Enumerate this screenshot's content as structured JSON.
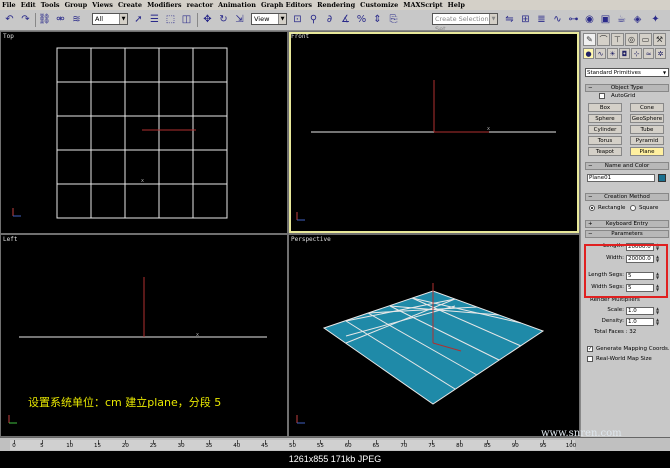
{
  "menu": [
    "File",
    "Edit",
    "Tools",
    "Group",
    "Views",
    "Create",
    "Modifiers",
    "reactor",
    "Animation",
    "Graph Editors",
    "Rendering",
    "Customize",
    "MAXScript",
    "Help"
  ],
  "toolbar": {
    "selection_filter": "All",
    "reference_coord": "View",
    "named_selection_placeholder": "Create Selection Set"
  },
  "viewports": {
    "top": "Top",
    "front": "Front",
    "left": "Left",
    "perspective": "Perspective"
  },
  "caption": "设置系统单位：cm 建立plane，分段 5",
  "command_panel": {
    "category": "Standard Primitives",
    "object_type_title": "Object Type",
    "autogrid": "AutoGrid",
    "buttons": [
      "Box",
      "Cone",
      "Sphere",
      "GeoSphere",
      "Cylinder",
      "Tube",
      "Torus",
      "Pyramid",
      "Teapot",
      "Plane"
    ],
    "active_button": "Plane",
    "name_color_title": "Name and Color",
    "object_name": "Plane01",
    "object_color": "#1a7090",
    "creation_method_title": "Creation Method",
    "method_rectangle": "Rectangle",
    "method_square": "Square",
    "keyboard_entry_title": "Keyboard Entry",
    "parameters_title": "Parameters",
    "length_label": "Length:",
    "length_value": "20000.0",
    "width_label": "Width:",
    "width_value": "20000.0",
    "length_segs_label": "Length Segs:",
    "length_segs_value": "5",
    "width_segs_label": "Width Segs:",
    "width_segs_value": "5",
    "render_multipliers": "Render Multipliers",
    "scale_label": "Scale:",
    "scale_value": "1.0",
    "density_label": "Density:",
    "density_value": "1.0",
    "total_faces": "Total Faces : 32",
    "gen_mapping": "Generate Mapping Coords.",
    "real_world": "Real-World Map Size"
  },
  "timeline": {
    "ticks": [
      "0",
      "5",
      "10",
      "15",
      "20",
      "25",
      "30",
      "35",
      "40",
      "45",
      "50",
      "55",
      "60",
      "65",
      "70",
      "75",
      "80",
      "85",
      "90",
      "95",
      "100"
    ]
  },
  "image_info": "1261x855  171kb  JPEG",
  "watermark": "www.snren.com"
}
